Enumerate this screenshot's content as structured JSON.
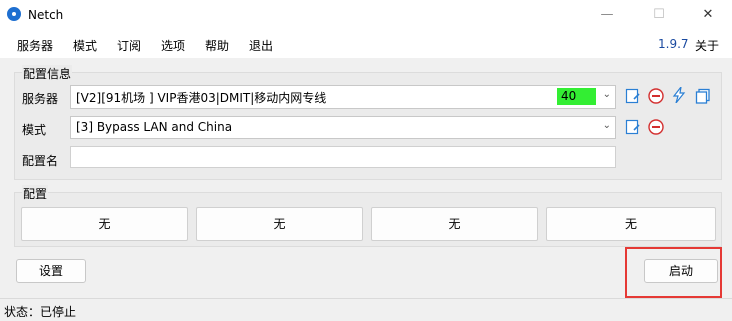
{
  "window": {
    "title": "Netch",
    "minimize": "—",
    "maximize": "☐",
    "close": "✕"
  },
  "menu": {
    "items": [
      "服务器",
      "模式",
      "订阅",
      "选项",
      "帮助",
      "退出"
    ],
    "version": "1.9.7",
    "about": "关于"
  },
  "config_info": {
    "title": "配置信息",
    "server_label": "服务器",
    "server_value": "[V2][91机场 ] VIP香港03|DMIT|移动内网专线",
    "server_ping": "40",
    "mode_label": "模式",
    "mode_value": "[3] Bypass LAN and China",
    "profile_name_label": "配置名",
    "profile_name_value": ""
  },
  "profiles": {
    "title": "配置",
    "buttons": [
      "无",
      "无",
      "无",
      "无"
    ]
  },
  "actions": {
    "settings": "设置",
    "start": "启动"
  },
  "status": {
    "text": "状态：已停止"
  },
  "colors": {
    "ping_bg": "#33ee33",
    "highlight": "#e53935",
    "version": "#1a4aa0",
    "icon_blue": "#2a7fd4",
    "icon_red": "#d32f2f"
  },
  "icons": [
    "app-icon",
    "edit-icon",
    "remove-icon",
    "speed-test-icon",
    "copy-icon"
  ]
}
